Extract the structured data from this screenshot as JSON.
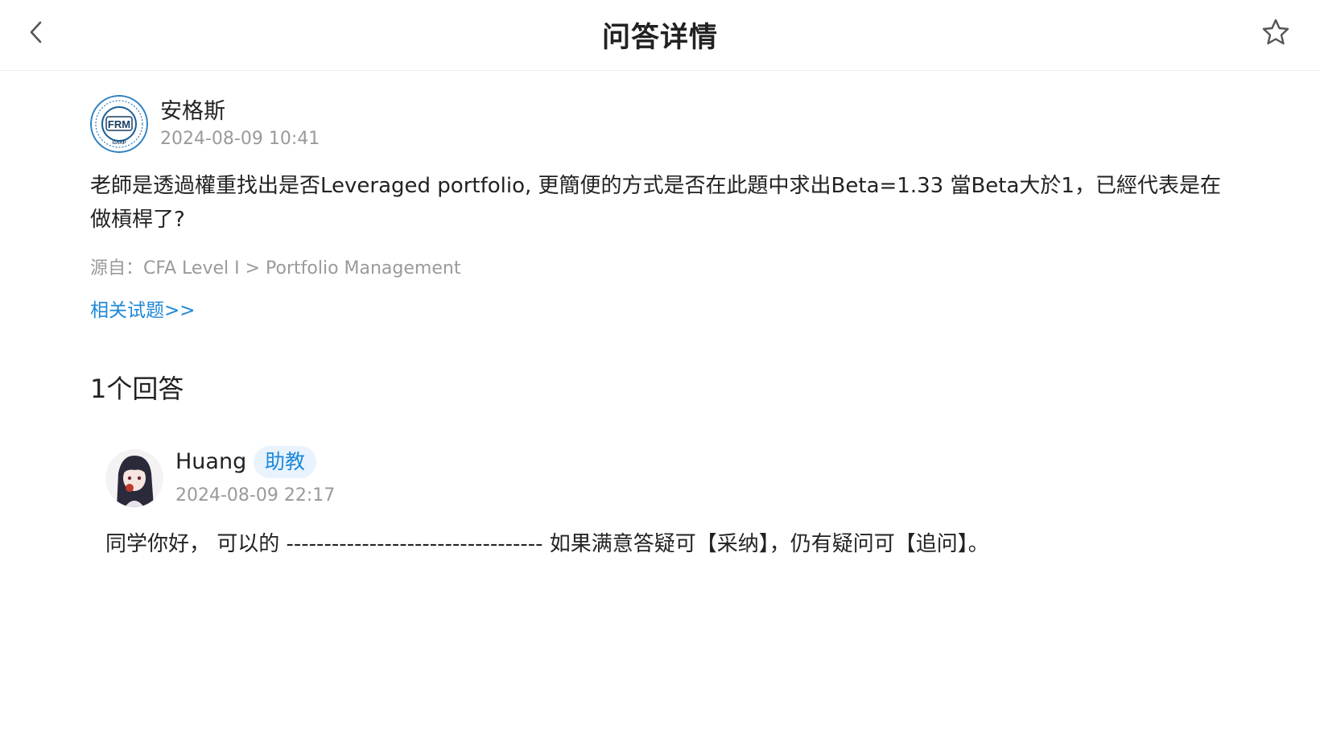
{
  "header": {
    "title": "问答详情",
    "back_icon": "chevron-left-icon",
    "favorite_icon": "star-outline-icon"
  },
  "question": {
    "author": "安格斯",
    "avatar_text": "FRM",
    "avatar_subtext": "GARP",
    "time": "2024-08-09 10:41",
    "body": "老師是透過權重找出是否Leveraged portfolio, 更簡便的方式是否在此題中求出Beta=1.33 當Beta大於1，已經代表是在做槓桿了?",
    "source_label": "源自：",
    "source_path": "CFA Level I > Portfolio Management",
    "related_link": "相关试题>>"
  },
  "answers": {
    "count_label": "1个回答",
    "items": [
      {
        "author": "Huang",
        "badge": "助教",
        "time": "2024-08-09 22:17",
        "body": "同学你好， 可以的 ---------------------------------- 如果满意答疑可【采纳】，仍有疑问可【追问】。"
      }
    ]
  },
  "colors": {
    "accent": "#1e88d8",
    "badge_bg": "#e8f3fd",
    "muted_text": "#9a9a9a",
    "primary_text": "#222222"
  }
}
